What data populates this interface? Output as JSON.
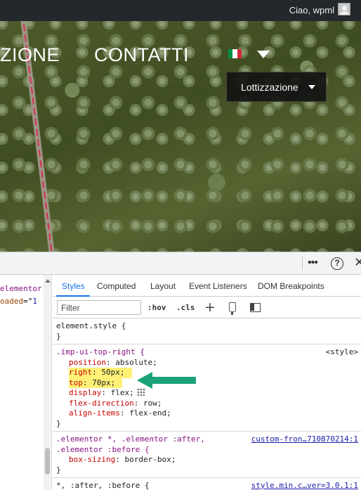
{
  "adminbar": {
    "greeting": "Ciao, wpml",
    "avatar_icon": "user-avatar-icon",
    "background": "#23282d"
  },
  "hero": {
    "nav_left_fragment": "ZIONE",
    "nav_contatti": "CONTATTI",
    "language_flag": "italian-flag",
    "flag_colors": [
      "#009246",
      "#ffffff",
      "#ce2b37"
    ],
    "language_dropdown_icon": "caret-down-icon",
    "lot_button_label": "Lottizzazione",
    "lot_button_icon": "caret-down-icon"
  },
  "devtools": {
    "toolbar_icons": [
      "more-icon",
      "help-icon",
      "close-icon"
    ],
    "dom_lines": {
      "line1": "elementor-",
      "line2_attr": "oaded",
      "line2_eq": "=\"",
      "line2_val": "1"
    },
    "tabs": [
      {
        "label": "Styles",
        "active": true
      },
      {
        "label": "Computed",
        "active": false
      },
      {
        "label": "Layout",
        "active": false
      },
      {
        "label": "Event Listeners",
        "active": false
      },
      {
        "label": "DOM Breakpoints",
        "active": false
      }
    ],
    "filter_placeholder": "Filter",
    "hov": ":hov",
    "cls": ".cls",
    "rules": [
      {
        "selector": "element.style {",
        "close": "}"
      },
      {
        "selector": ".imp-ui-top-right {",
        "source": "<style>",
        "declarations": [
          {
            "prop": "position",
            "value": "absolute;",
            "highlight": false
          },
          {
            "prop": "right",
            "value": "50px;",
            "highlight": true
          },
          {
            "prop": "top",
            "value": "70px;",
            "highlight": true
          },
          {
            "prop": "display",
            "value": "flex;",
            "highlight": false
          },
          {
            "prop": "flex-direction",
            "value": "row;",
            "highlight": false
          },
          {
            "prop": "align-items",
            "value": "flex-end;",
            "highlight": false
          }
        ],
        "close": "}"
      },
      {
        "selector_line1": ".elementor *, .elementor :after,",
        "selector_line2": ".elementor :before {",
        "source": "custom-fron…710870214:1",
        "declarations": [
          {
            "prop": "box-sizing",
            "value": "border-box;"
          }
        ],
        "close": "}"
      },
      {
        "selector": "*, :after, :before {",
        "source": "style.min.c…ver=3.0.1:1"
      }
    ],
    "highlight_color": "#fff176",
    "annotation_arrow_color": "#1aa37a"
  }
}
